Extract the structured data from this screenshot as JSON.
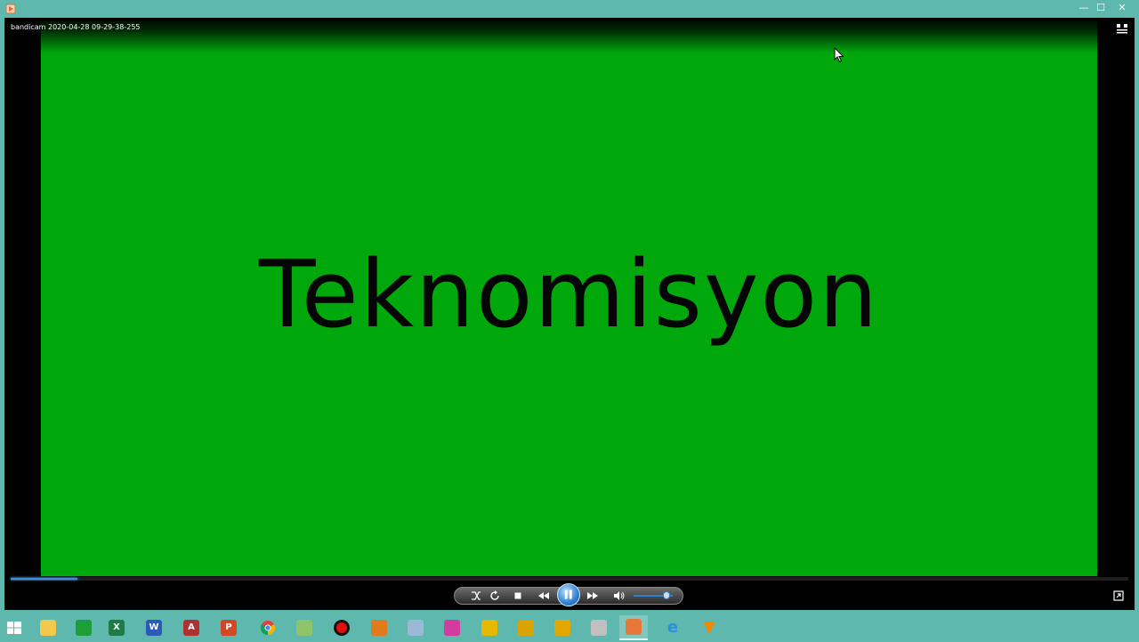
{
  "window": {
    "title_icon": "player-app-icon",
    "buttons": {
      "minimize": "—",
      "maximize": "☐",
      "close": "✕"
    }
  },
  "video": {
    "file_title": "bandicam 2020-04-28 09-29-38-255",
    "caption": "Teknomisyon",
    "background_color": "#00a80c",
    "seek_progress": 0.06,
    "volume_level": 0.85
  },
  "controls": {
    "icons": [
      "shuffle-icon",
      "repeat-icon",
      "stop-icon",
      "previous-icon",
      "pause-icon",
      "next-icon",
      "volume-icon"
    ]
  },
  "taskbar": {
    "items": [
      {
        "name": "start-button",
        "glyph": "",
        "color": "#5fb8ae"
      },
      {
        "name": "file-explorer",
        "glyph": "",
        "color": "#f2c94c"
      },
      {
        "name": "store",
        "glyph": "",
        "color": "#1e9e3a"
      },
      {
        "name": "excel",
        "glyph": "X",
        "color": "#1f7a44"
      },
      {
        "name": "word",
        "glyph": "W",
        "color": "#2b5bb5"
      },
      {
        "name": "access",
        "glyph": "A",
        "color": "#b03030"
      },
      {
        "name": "powerpoint",
        "glyph": "P",
        "color": "#d24726"
      },
      {
        "name": "chrome",
        "glyph": "",
        "color": "#e0e0e0"
      },
      {
        "name": "notepad-plus",
        "glyph": "",
        "color": "#8fc46a"
      },
      {
        "name": "bandicam",
        "glyph": "",
        "color": "#d01010"
      },
      {
        "name": "cross-tool",
        "glyph": "",
        "color": "#e07a1a"
      },
      {
        "name": "document-app",
        "glyph": "",
        "color": "#9ab8d8"
      },
      {
        "name": "pink-app",
        "glyph": "",
        "color": "#d23ca0"
      },
      {
        "name": "yellow-app-1",
        "glyph": "",
        "color": "#e6b800"
      },
      {
        "name": "yellow-app-2",
        "glyph": "",
        "color": "#d9a400"
      },
      {
        "name": "yellow-app-3",
        "glyph": "",
        "color": "#e0a800"
      },
      {
        "name": "network-app",
        "glyph": "",
        "color": "#c0c0c0"
      },
      {
        "name": "media-player",
        "glyph": "",
        "color": "#e8773a"
      },
      {
        "name": "internet-explorer",
        "glyph": "e",
        "color": "#2b8fe0"
      },
      {
        "name": "vlc",
        "glyph": "",
        "color": "#f08a00"
      }
    ]
  }
}
